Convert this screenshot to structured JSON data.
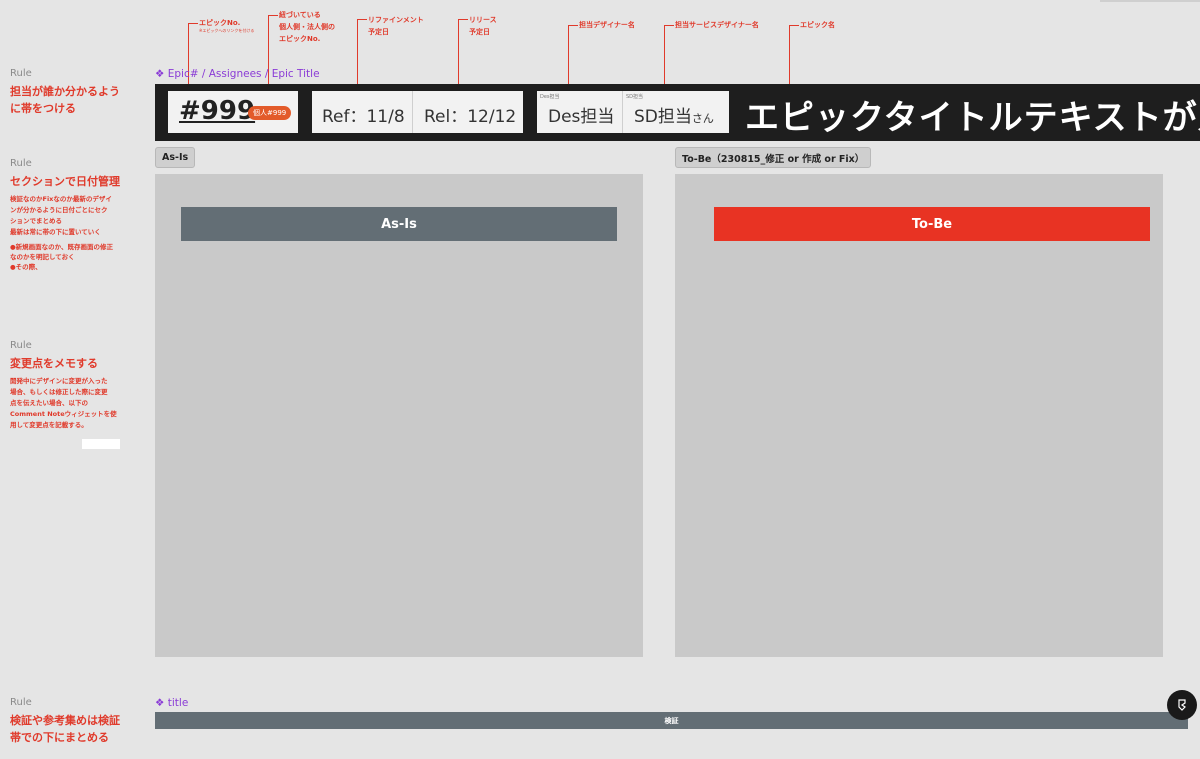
{
  "annotations": {
    "epic_no": "エピックNo.",
    "epic_no_sub": "※エピックへのリンクを付ける",
    "linked": [
      "紐づいている",
      "個人側・法人側の",
      "エピックNo."
    ],
    "refinement": [
      "リファインメント",
      "予定日"
    ],
    "release": [
      "リリース",
      "予定日"
    ],
    "designer": "担当デザイナー名",
    "service_designer": "担当サービスデザイナー名",
    "epic_name": "エピック名"
  },
  "rules": [
    {
      "kicker": "Rule",
      "title": [
        "担当が誰か分かるよう",
        "に帯をつける"
      ]
    },
    {
      "kicker": "Rule",
      "title": [
        "セクションで日付管理"
      ],
      "body": [
        "検証なのかFixなのか最新のデザイ",
        "ンが分かるように日付ごとにセク",
        "ションでまとめる",
        "最新は常に帯の下に置いていく"
      ],
      "notes": [
        "●新規画面なのか、既存画面の修正",
        "なのかを明記しておく",
        "●その際、"
      ]
    },
    {
      "kicker": "Rule",
      "title": [
        "変更点をメモする"
      ],
      "body": [
        "開発中にデザインに変更が入った",
        "場合、もしくは修正した際に変更",
        "点を伝えたい場合、以下の",
        "Comment Noteウィジェットを使",
        "用して変更点を記載する。"
      ]
    },
    {
      "kicker": "Rule",
      "title": [
        "検証や参考集めは検証",
        "帯での下にまとめる"
      ]
    }
  ],
  "header": {
    "frame_label": "❖ Epic# / Assignees / Epic Title",
    "epic_no": "#999",
    "linked_pill": "個人#999",
    "ref": "Ref：11/8",
    "rel": "Rel：12/12",
    "des_label": "Des担当",
    "des_name": "Des担当",
    "sd_label": "SD担当",
    "sd_name": "SD担当",
    "sd_suffix": "さん",
    "epic_title": "エピックタイトルテキストが入ります"
  },
  "sections": {
    "asis_tag": "As-Is",
    "tobe_tag": "To-Be（230815_修正 or 作成 or Fix）",
    "asis_bar": "As-Is",
    "tobe_bar": "To-Be"
  },
  "bottom": {
    "frame_label": "❖ title",
    "bar_label": "検証"
  },
  "fab": {
    "icon": "figma-plugin-icon"
  },
  "colors": {
    "accent_red": "#e03a2b",
    "tobe_bar": "#e83323",
    "asis_bar": "#636e75",
    "frame_purple": "#8a3bd6",
    "band": "#1e1e1e"
  }
}
